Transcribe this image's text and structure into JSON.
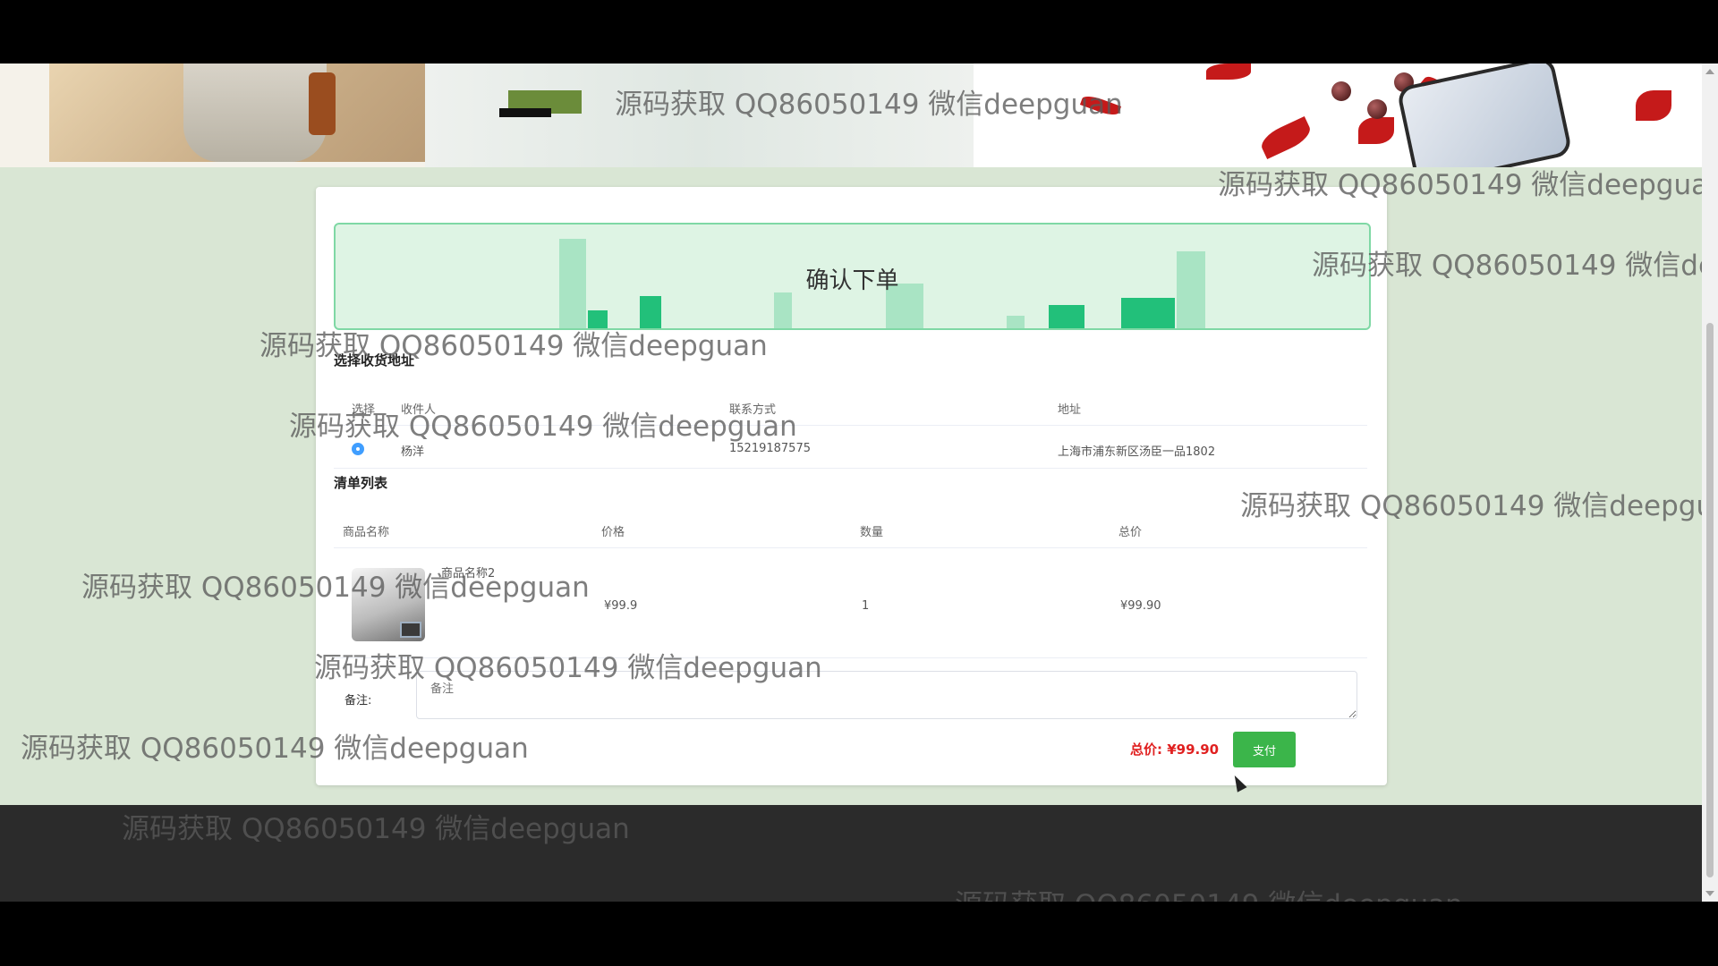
{
  "banner": {
    "logo_text": "",
    "colors": {
      "logo_green": "#6b8c3a",
      "petal_red": "#c51a1a"
    }
  },
  "order": {
    "hero_title": "确认下单",
    "address_section_title": "选择收货地址",
    "address_columns": [
      "选择",
      "收件人",
      "联系方式",
      "地址"
    ],
    "address_rows": [
      {
        "selected": true,
        "name": "杨洋",
        "phone": "15219187575",
        "address": "上海市浦东新区汤臣一品1802"
      }
    ],
    "items_section_title": "清单列表",
    "item_columns": [
      "商品名称",
      "价格",
      "数量",
      "总价"
    ],
    "items": [
      {
        "name": "商品名称2",
        "image_icon": "cash-counter-machine-image",
        "price": "¥99.9",
        "quantity": "1",
        "subtotal": "¥99.90"
      }
    ],
    "remark_label": "备注:",
    "remark_placeholder": "备注",
    "total_label": "总价: ¥99.90",
    "pay_button": "支付",
    "colors": {
      "accent_green": "#3bb54a",
      "total_red": "#e02020",
      "radio_blue": "#409eff"
    }
  },
  "watermark": {
    "text": "源码获取 QQ86050149 微信deepguan"
  }
}
